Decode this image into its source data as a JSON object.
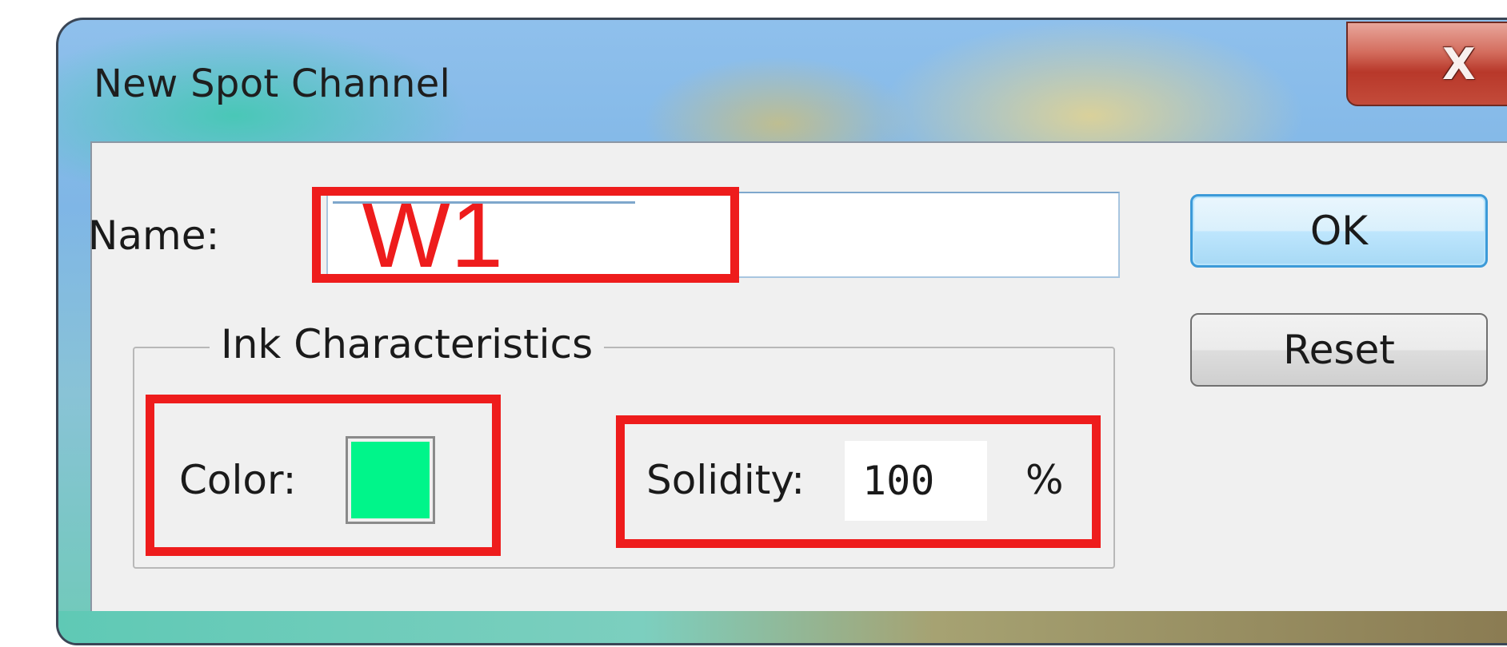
{
  "dialog": {
    "title": "New Spot Channel",
    "close_glyph": "X"
  },
  "name": {
    "label": "Name:",
    "value": "W1"
  },
  "buttons": {
    "ok": "OK",
    "reset": "Reset"
  },
  "ink": {
    "group_label": "Ink Characteristics",
    "color_label": "Color:",
    "color_value": "#00f58a",
    "solidity_label": "Solidity:",
    "solidity_value": "100",
    "solidity_unit": "%"
  },
  "annotation_color": "#ee1c1c"
}
